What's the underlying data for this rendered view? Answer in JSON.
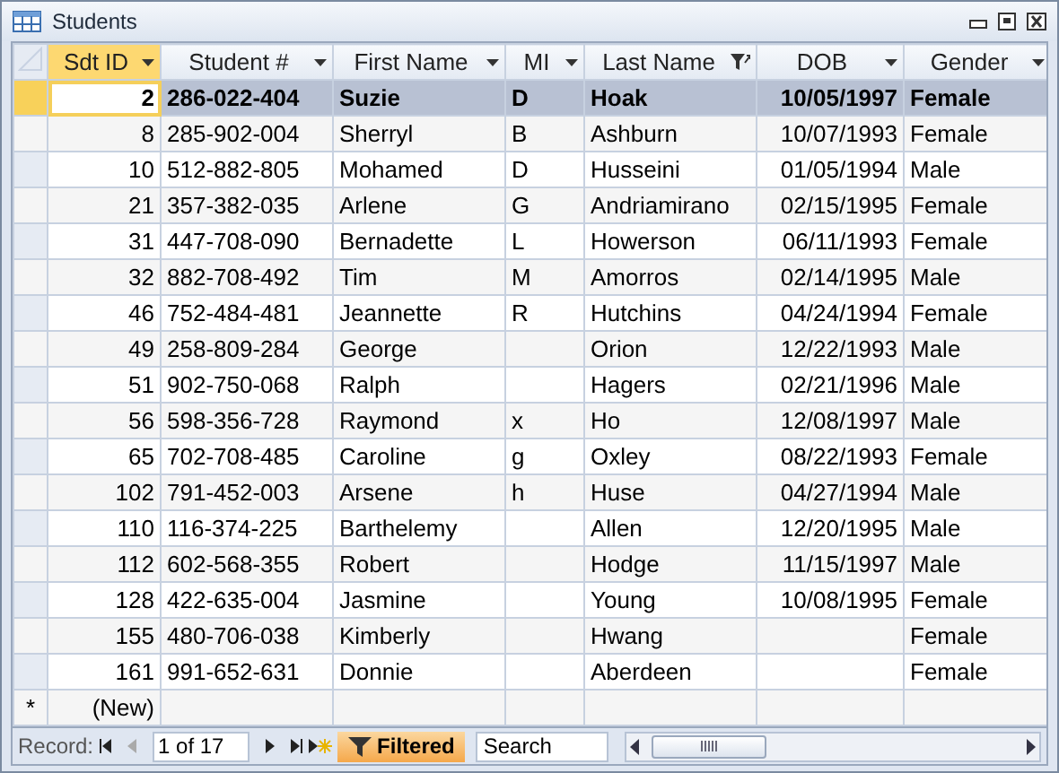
{
  "window": {
    "title": "Students"
  },
  "table": {
    "columns": [
      {
        "label": "Sdt ID",
        "selected": true,
        "filtered": false
      },
      {
        "label": "Student #",
        "selected": false,
        "filtered": false
      },
      {
        "label": "First Name",
        "selected": false,
        "filtered": false
      },
      {
        "label": "MI",
        "selected": false,
        "filtered": false
      },
      {
        "label": "Last Name",
        "selected": false,
        "filtered": true
      },
      {
        "label": "DOB",
        "selected": false,
        "filtered": false
      },
      {
        "label": "Gender",
        "selected": false,
        "filtered": false
      }
    ],
    "rows": [
      {
        "selected": true,
        "cells": [
          "2",
          "286-022-404",
          "Suzie",
          "D",
          "Hoak",
          "10/05/1997",
          "Female"
        ]
      },
      {
        "selected": false,
        "cells": [
          "8",
          "285-902-004",
          "Sherryl",
          "B",
          "Ashburn",
          "10/07/1993",
          "Female"
        ]
      },
      {
        "selected": false,
        "cells": [
          "10",
          "512-882-805",
          "Mohamed",
          "D",
          "Husseini",
          "01/05/1994",
          "Male"
        ]
      },
      {
        "selected": false,
        "cells": [
          "21",
          "357-382-035",
          "Arlene",
          "G",
          "Andriamirano",
          "02/15/1995",
          "Female"
        ]
      },
      {
        "selected": false,
        "cells": [
          "31",
          "447-708-090",
          "Bernadette",
          "L",
          "Howerson",
          "06/11/1993",
          "Female"
        ]
      },
      {
        "selected": false,
        "cells": [
          "32",
          "882-708-492",
          "Tim",
          "M",
          "Amorros",
          "02/14/1995",
          "Male"
        ]
      },
      {
        "selected": false,
        "cells": [
          "46",
          "752-484-481",
          "Jeannette",
          "R",
          "Hutchins",
          "04/24/1994",
          "Female"
        ]
      },
      {
        "selected": false,
        "cells": [
          "49",
          "258-809-284",
          "George",
          "",
          "Orion",
          "12/22/1993",
          "Male"
        ]
      },
      {
        "selected": false,
        "cells": [
          "51",
          "902-750-068",
          "Ralph",
          "",
          "Hagers",
          "02/21/1996",
          "Male"
        ]
      },
      {
        "selected": false,
        "cells": [
          "56",
          "598-356-728",
          "Raymond",
          "x",
          "Ho",
          "12/08/1997",
          "Male"
        ]
      },
      {
        "selected": false,
        "cells": [
          "65",
          "702-708-485",
          "Caroline",
          "g",
          "Oxley",
          "08/22/1993",
          "Female"
        ]
      },
      {
        "selected": false,
        "cells": [
          "102",
          "791-452-003",
          "Arsene",
          "h",
          "Huse",
          "04/27/1994",
          "Male"
        ]
      },
      {
        "selected": false,
        "cells": [
          "110",
          "116-374-225",
          "Barthelemy",
          "",
          "Allen",
          "12/20/1995",
          "Male"
        ]
      },
      {
        "selected": false,
        "cells": [
          "112",
          "602-568-355",
          "Robert",
          "",
          "Hodge",
          "11/15/1997",
          "Male"
        ]
      },
      {
        "selected": false,
        "cells": [
          "128",
          "422-635-004",
          "Jasmine",
          "",
          "Young",
          "10/08/1995",
          "Female"
        ]
      },
      {
        "selected": false,
        "cells": [
          "155",
          "480-706-038",
          "Kimberly",
          "",
          "Hwang",
          "",
          "Female"
        ]
      },
      {
        "selected": false,
        "cells": [
          "161",
          "991-652-631",
          "Donnie",
          "",
          "Aberdeen",
          "",
          "Female"
        ]
      }
    ],
    "new_row": {
      "marker": "*",
      "label": "(New)"
    }
  },
  "navigation": {
    "label": "Record:",
    "position": "1 of 17",
    "filter_label": "Filtered",
    "search": {
      "placeholder": "Search"
    }
  }
}
